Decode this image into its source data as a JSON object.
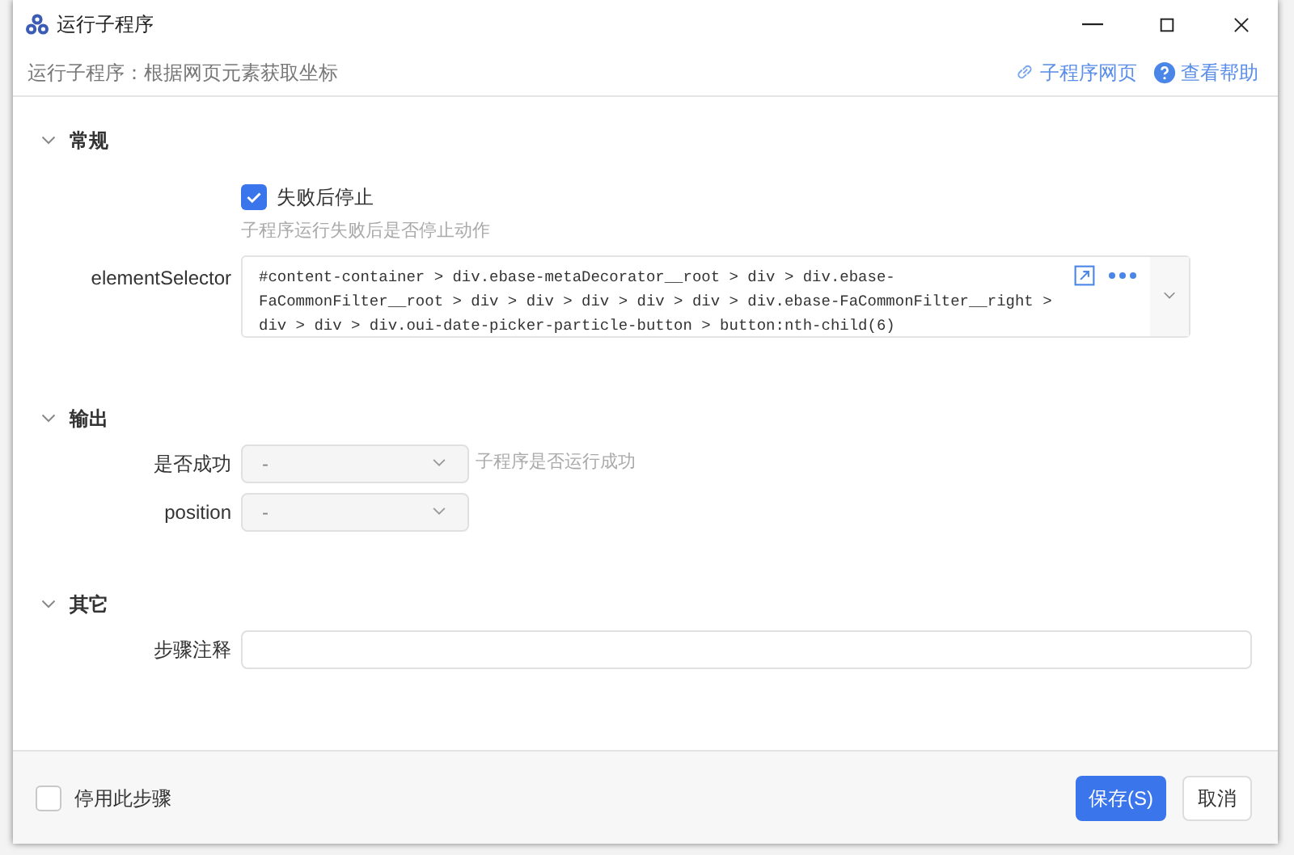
{
  "window": {
    "title": "运行子程序",
    "subtitle": "运行子程序：根据网页元素获取坐标",
    "links": [
      {
        "label": "子程序网页",
        "kind": "link"
      },
      {
        "label": "查看帮助",
        "kind": "help"
      }
    ]
  },
  "sections": [
    {
      "title": "常规",
      "expanded": true,
      "fields": [
        {
          "kind": "checkbox",
          "label": "失败后停止",
          "checked": true,
          "hint": "子程序运行失败后是否停止动作"
        },
        {
          "kind": "selector",
          "label": "elementSelector",
          "value": "#content-container > div.ebase-metaDecorator__root > div > div.ebase-FaCommonFilter__root > div > div > div > div > div > div.ebase-FaCommonFilter__right > div > div > div.oui-date-picker-particle-button > button:nth-child(6)"
        }
      ]
    },
    {
      "title": "输出",
      "expanded": true,
      "fields": [
        {
          "kind": "select",
          "label": "是否成功",
          "value": "-",
          "hint": "子程序是否运行成功",
          "disabled": true
        },
        {
          "kind": "select",
          "label": "position",
          "value": "-",
          "disabled": true
        }
      ]
    },
    {
      "title": "其它",
      "expanded": true,
      "fields": [
        {
          "kind": "text",
          "label": "步骤注释"
        }
      ]
    }
  ],
  "footer": {
    "disable_step": {
      "label": "停用此步骤",
      "checked": false
    },
    "buttons": [
      {
        "label": "保存(S)",
        "kind": "primary"
      },
      {
        "label": "取消",
        "kind": "default"
      }
    ]
  }
}
